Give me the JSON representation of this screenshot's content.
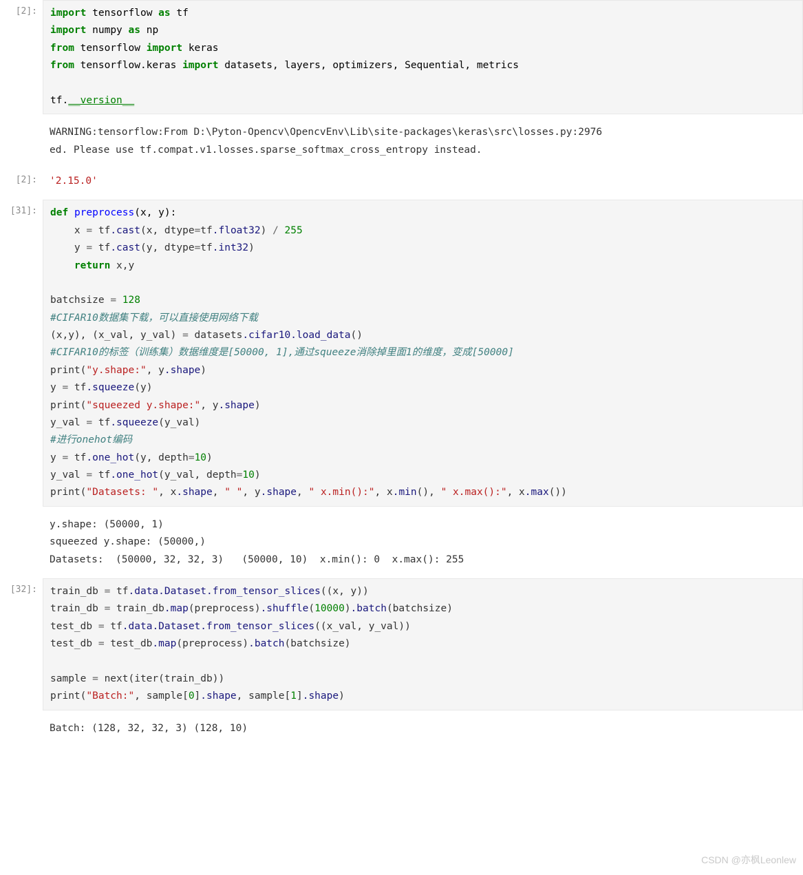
{
  "cells": {
    "c0": {
      "prompt": "[2]:",
      "tokens": {
        "t0": "import",
        "t1": "tensorflow",
        "t2": "as",
        "t3": "tf",
        "t4": "import",
        "t5": "numpy",
        "t6": "as",
        "t7": "np",
        "t8": "from",
        "t9": "tensorflow",
        "t10": "import",
        "t11": "keras",
        "t12": "from",
        "t13": "tensorflow.keras",
        "t14": "import",
        "t15": "datasets, layers, optimizers, Sequential, metrics",
        "t16": "tf.",
        "t17": "__version__"
      }
    },
    "c0out": {
      "text": "WARNING:tensorflow:From D:\\Pyton-Opencv\\OpencvEnv\\Lib\\site-packages\\keras\\src\\losses.py:2976\ned. Please use tf.compat.v1.losses.sparse_softmax_cross_entropy instead."
    },
    "c0res": {
      "prompt": "[2]:",
      "text": "'2.15.0'"
    },
    "c1": {
      "prompt": "[31]:",
      "tokens": {
        "d0": "def",
        "d1": "preprocess",
        "d2": "(x, y):",
        "l1a": "    x ",
        "l1b": "=",
        "l1c": " tf",
        "l1d": ".cast",
        "l1e": "(x, dtype",
        "l1f": "=",
        "l1g": "tf",
        "l1h": ".float32",
        "l1i": ") ",
        "l1j": "/",
        "l1k": " ",
        "l1l": "255",
        "l2a": "    y ",
        "l2b": "=",
        "l2c": " tf",
        "l2d": ".cast",
        "l2e": "(y, dtype",
        "l2f": "=",
        "l2g": "tf",
        "l2h": ".int32",
        "l2i": ")",
        "l3a": "    ",
        "l3b": "return",
        "l3c": " x,y",
        "l4a": "batchsize ",
        "l4b": "=",
        "l4c": " ",
        "l4d": "128",
        "l5": "#CIFAR10数据集下载，可以直接使用网络下载",
        "l6a": "(x,y), (x_val, y_val) ",
        "l6b": "=",
        "l6c": " datasets",
        "l6d": ".cifar10",
        "l6e": ".load_data",
        "l6f": "()",
        "l7": "#CIFAR10的标签（训练集）数据维度是[50000, 1],通过squeeze消除掉里面1的维度，变成[50000]",
        "l8a": "print(",
        "l8b": "\"y.shape:\"",
        "l8c": ", y",
        "l8d": ".shape",
        "l8e": ")",
        "l9a": "y ",
        "l9b": "=",
        "l9c": " tf",
        "l9d": ".squeeze",
        "l9e": "(y)",
        "l10a": "print(",
        "l10b": "\"squeezed y.shape:\"",
        "l10c": ", y",
        "l10d": ".shape",
        "l10e": ")",
        "l11a": "y_val ",
        "l11b": "=",
        "l11c": " tf",
        "l11d": ".squeeze",
        "l11e": "(y_val)",
        "l12": "#进行onehot编码",
        "l13a": "y ",
        "l13b": "=",
        "l13c": " tf",
        "l13d": ".one_hot",
        "l13e": "(y, depth",
        "l13f": "=",
        "l13g": "10",
        "l13h": ")",
        "l14a": "y_val ",
        "l14b": "=",
        "l14c": " tf",
        "l14d": ".one_hot",
        "l14e": "(y_val, depth",
        "l14f": "=",
        "l14g": "10",
        "l14h": ")",
        "l15a": "print(",
        "l15b": "\"Datasets: \"",
        "l15c": ", x",
        "l15d": ".shape",
        "l15e": ", ",
        "l15f": "\" \"",
        "l15g": ", y",
        "l15h": ".shape",
        "l15i": ", ",
        "l15j": "\" x.min():\"",
        "l15k": ", x",
        "l15l": ".min",
        "l15m": "(), ",
        "l15n": "\" x.max():\"",
        "l15o": ", x",
        "l15p": ".max",
        "l15q": "())"
      }
    },
    "c1out": {
      "text": "y.shape: (50000, 1)\nsqueezed y.shape: (50000,)\nDatasets:  (50000, 32, 32, 3)   (50000, 10)  x.min(): 0  x.max(): 255"
    },
    "c2": {
      "prompt": "[32]:",
      "tokens": {
        "m1a": "train_db ",
        "m1b": "=",
        "m1c": " tf",
        "m1d": ".data",
        "m1e": ".Dataset",
        "m1f": ".from_tensor_slices",
        "m1g": "((x, y))",
        "m2a": "train_db ",
        "m2b": "=",
        "m2c": " train_db",
        "m2d": ".map",
        "m2e": "(preprocess)",
        "m2f": ".shuffle",
        "m2g": "(",
        "m2h": "10000",
        "m2i": ")",
        "m2j": ".batch",
        "m2k": "(batchsize)",
        "m3a": "test_db ",
        "m3b": "=",
        "m3c": " tf",
        "m3d": ".data",
        "m3e": ".Dataset",
        "m3f": ".from_tensor_slices",
        "m3g": "((x_val, y_val))",
        "m4a": "test_db ",
        "m4b": "=",
        "m4c": " test_db",
        "m4d": ".map",
        "m4e": "(preprocess)",
        "m4f": ".batch",
        "m4g": "(batchsize)",
        "m5a": "sample ",
        "m5b": "=",
        "m5c": " next(iter(train_db))",
        "m6a": "print(",
        "m6b": "\"Batch:\"",
        "m6c": ", sample[",
        "m6d": "0",
        "m6e": "]",
        "m6f": ".shape",
        "m6g": ", sample[",
        "m6h": "1",
        "m6i": "]",
        "m6j": ".shape",
        "m6k": ")"
      }
    },
    "c2out": {
      "text": "Batch: (128, 32, 32, 3) (128, 10)"
    }
  },
  "watermark": "CSDN @亦枫Leonlew"
}
